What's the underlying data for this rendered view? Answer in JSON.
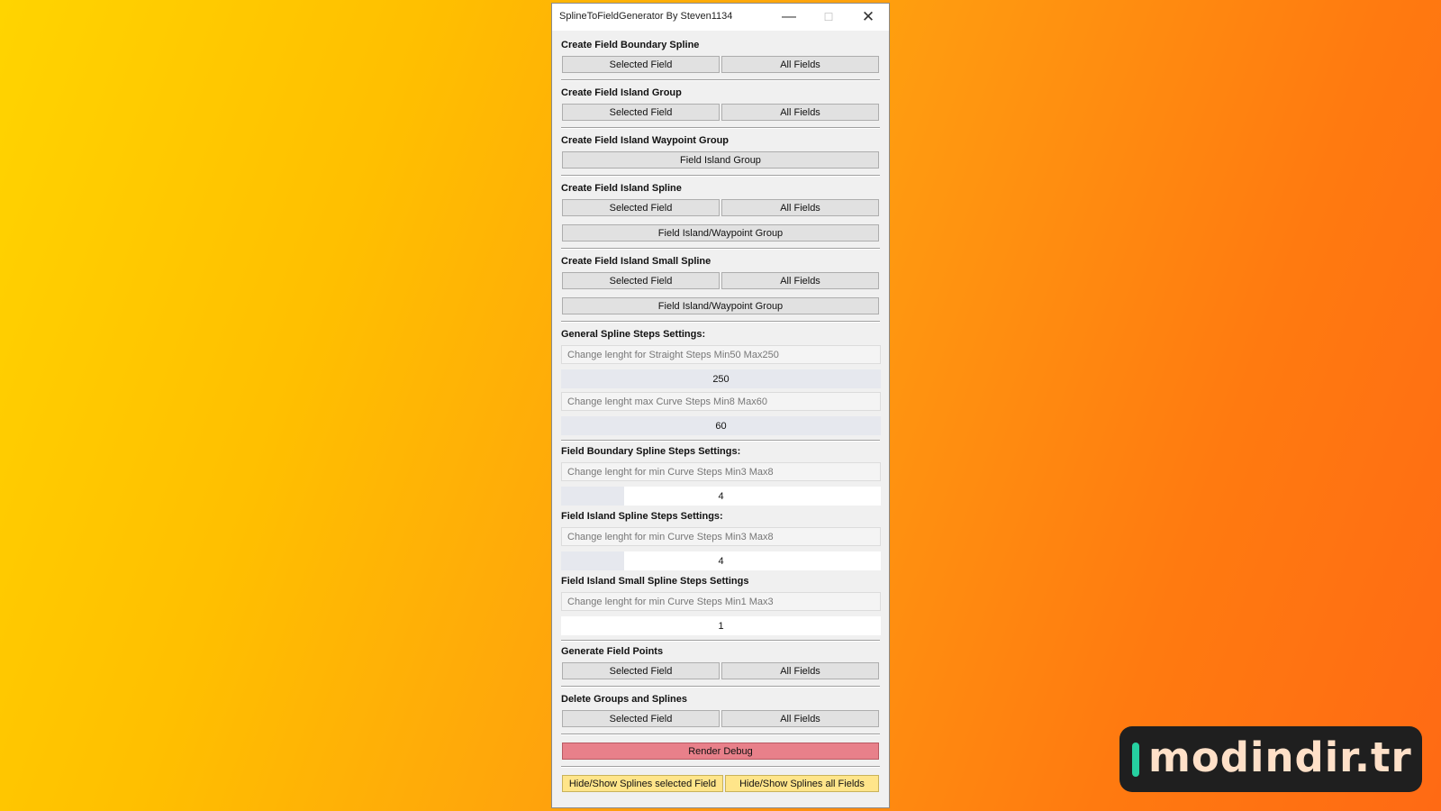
{
  "window": {
    "title": "SplineToFieldGenerator By Steven1134",
    "controls": {
      "minimize": "—",
      "maximize": "☐",
      "close": "✕"
    }
  },
  "sections": {
    "boundary": {
      "header": "Create Field Boundary Spline",
      "selected": "Selected Field",
      "all": "All Fields"
    },
    "island_group": {
      "header": "Create Field Island Group",
      "selected": "Selected Field",
      "all": "All Fields"
    },
    "waypoint_group": {
      "header": "Create Field Island Waypoint Group",
      "button": "Field Island Group"
    },
    "island_spline": {
      "header": "Create Field Island Spline",
      "selected": "Selected Field",
      "all": "All Fields",
      "group": "Field Island/Waypoint Group"
    },
    "island_small": {
      "header": "Create Field Island Small Spline",
      "selected": "Selected Field",
      "all": "All Fields",
      "group": "Field Island/Waypoint Group"
    },
    "general": {
      "header": "General Spline Steps Settings:",
      "straight_placeholder": "Change lenght for Straight Steps Min50 Max250",
      "straight_value": "250",
      "curve_placeholder": "Change lenght max Curve Steps Min8 Max60",
      "curve_value": "60"
    },
    "boundary_steps": {
      "header": "Field Boundary Spline Steps Settings:",
      "placeholder": "Change lenght for min Curve Steps Min3 Max8",
      "value": "4"
    },
    "island_steps": {
      "header": "Field Island Spline Steps Settings:",
      "placeholder": "Change lenght for min Curve Steps Min3 Max8",
      "value": "4"
    },
    "small_steps": {
      "header": "Field Island Small Spline Steps Settings",
      "placeholder": "Change lenght for min Curve Steps Min1 Max3",
      "value": "1"
    },
    "points": {
      "header": "Generate Field Points",
      "selected": "Selected Field",
      "all": "All Fields"
    },
    "delete": {
      "header": "Delete Groups and Splines",
      "selected": "Selected Field",
      "all": "All Fields"
    },
    "render_debug": "Render Debug",
    "hide_selected": "Hide/Show Splines selected Field",
    "hide_all": "Hide/Show Splines all Fields"
  },
  "colors": {
    "render_debug": "#e8808a",
    "hide_buttons": "#ffe58a",
    "accent_bar": "#26d0a0"
  },
  "watermark": {
    "text": "modindir.tr"
  }
}
